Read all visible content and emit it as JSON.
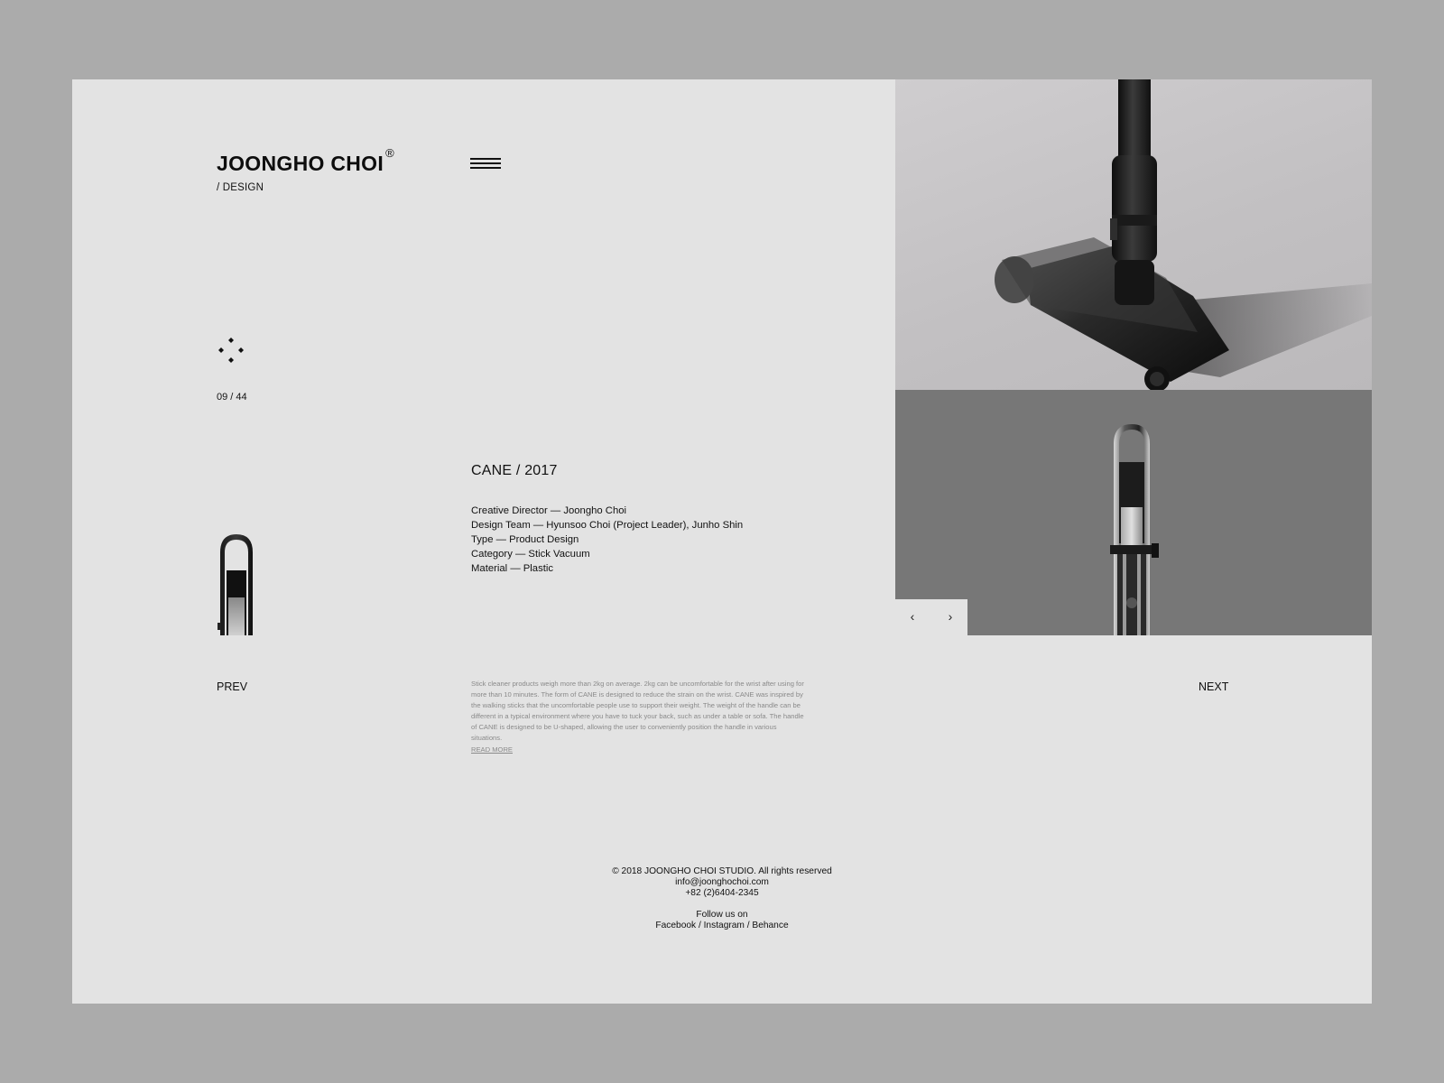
{
  "brand": {
    "name": "JOONGHO CHOI",
    "registered": "®",
    "subtitle": "/ DESIGN"
  },
  "nav": {
    "menu_icon": "hamburger-menu-icon",
    "move_icon": "four-dots-icon",
    "counter": "09 / 44",
    "prev_label": "PREV",
    "next_label": "NEXT"
  },
  "project": {
    "title": "CANE / 2017",
    "details": [
      "Creative Director — Joongho Choi",
      "Design Team — Hyunsoo Choi (Project Leader), Junho Shin",
      "Type — Product Design",
      "Category — Stick Vacuum",
      "Material — Plastic"
    ],
    "description": "Stick cleaner products weigh more than 2kg on average. 2kg can be uncomfortable for the wrist after using for more than 10 minutes. The form of CANE is designed to reduce the strain on the wrist. CANE was inspired by the walking sticks that the uncomfortable people use to support their weight. The weight of the handle can be different in a typical environment where you have to tuck your back, such as under a table or sofa. The handle of CANE is designed to be U-shaped, allowing the user to conveniently position the handle in various situations.",
    "read_more": "READ MORE"
  },
  "gallery": {
    "prev_arrow": "‹",
    "next_arrow": "›",
    "colors": {
      "top_bg": "#c4c2c4",
      "bottom_bg": "#777777"
    }
  },
  "footer": {
    "copyright": "© 2018 JOONGHO CHOI STUDIO. All rights reserved",
    "email": "info@joonghochoi.com",
    "phone": "+82 (2)6404-2345",
    "follow": "Follow us on",
    "social": "Facebook / Instagram / Behance"
  }
}
